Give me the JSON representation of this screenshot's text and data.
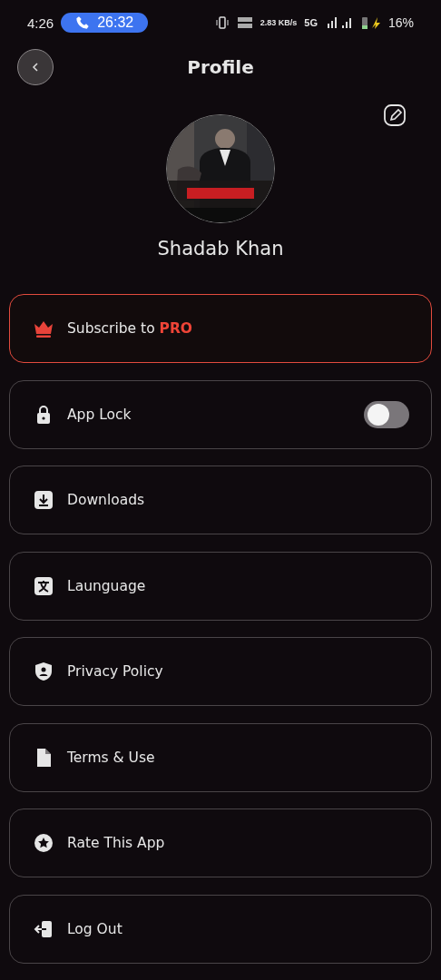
{
  "status_bar": {
    "time": "4:26",
    "call_timer": "26:32",
    "speed": "2.83 KB/s",
    "network": "5G",
    "battery": "16%"
  },
  "header": {
    "title": "Profile"
  },
  "profile": {
    "name": "Shadab Khan"
  },
  "menu": [
    {
      "kind": "pro",
      "label": "Subscribe to **PRO**"
    },
    {
      "kind": "toggle",
      "label": "App Lock",
      "on": false
    },
    {
      "kind": "link",
      "label": "Downloads"
    },
    {
      "kind": "link",
      "label": "Launguage"
    },
    {
      "kind": "link",
      "label": "Privacy Policy"
    },
    {
      "kind": "link",
      "label": "Terms & Use"
    },
    {
      "kind": "link",
      "label": "Rate This App"
    },
    {
      "kind": "link",
      "label": "Log Out"
    }
  ]
}
